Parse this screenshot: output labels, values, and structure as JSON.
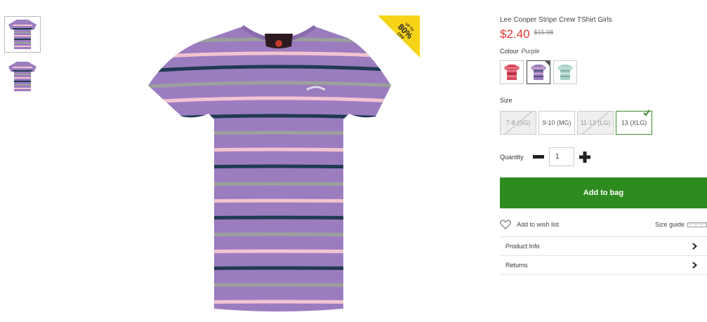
{
  "product": {
    "title": "Lee Cooper Stripe Crew TShirt Girls",
    "price_now": "$2.40",
    "price_was": "$15.98",
    "badge": {
      "line1": "UP TO",
      "line2": "80%",
      "line3": "OFF"
    }
  },
  "colour": {
    "label": "Colour",
    "selected": "Purple",
    "options": [
      {
        "name": "Red",
        "hex": "#d8475c"
      },
      {
        "name": "Purple",
        "hex": "#9b7cbf"
      },
      {
        "name": "Mint",
        "hex": "#a8d3c8"
      }
    ]
  },
  "size": {
    "label": "Size",
    "options": [
      {
        "label": "7-8 (SG)",
        "available": false
      },
      {
        "label": "9-10 (MG)",
        "available": true
      },
      {
        "label": "11-12 (LG)",
        "available": false
      },
      {
        "label": "13 (XLG)",
        "available": true,
        "selected": true
      }
    ]
  },
  "quantity": {
    "label": "Quantity",
    "value": "1"
  },
  "actions": {
    "add_to_bag": "Add to bag",
    "wishlist": "Add to wish list",
    "size_guide": "Size guide"
  },
  "accordion": [
    {
      "label": "Product Info"
    },
    {
      "label": "Returns"
    }
  ],
  "colors": {
    "accent_green": "#2e8b1f",
    "sale_red": "#e53935",
    "shirt": "#9b7cbf"
  }
}
